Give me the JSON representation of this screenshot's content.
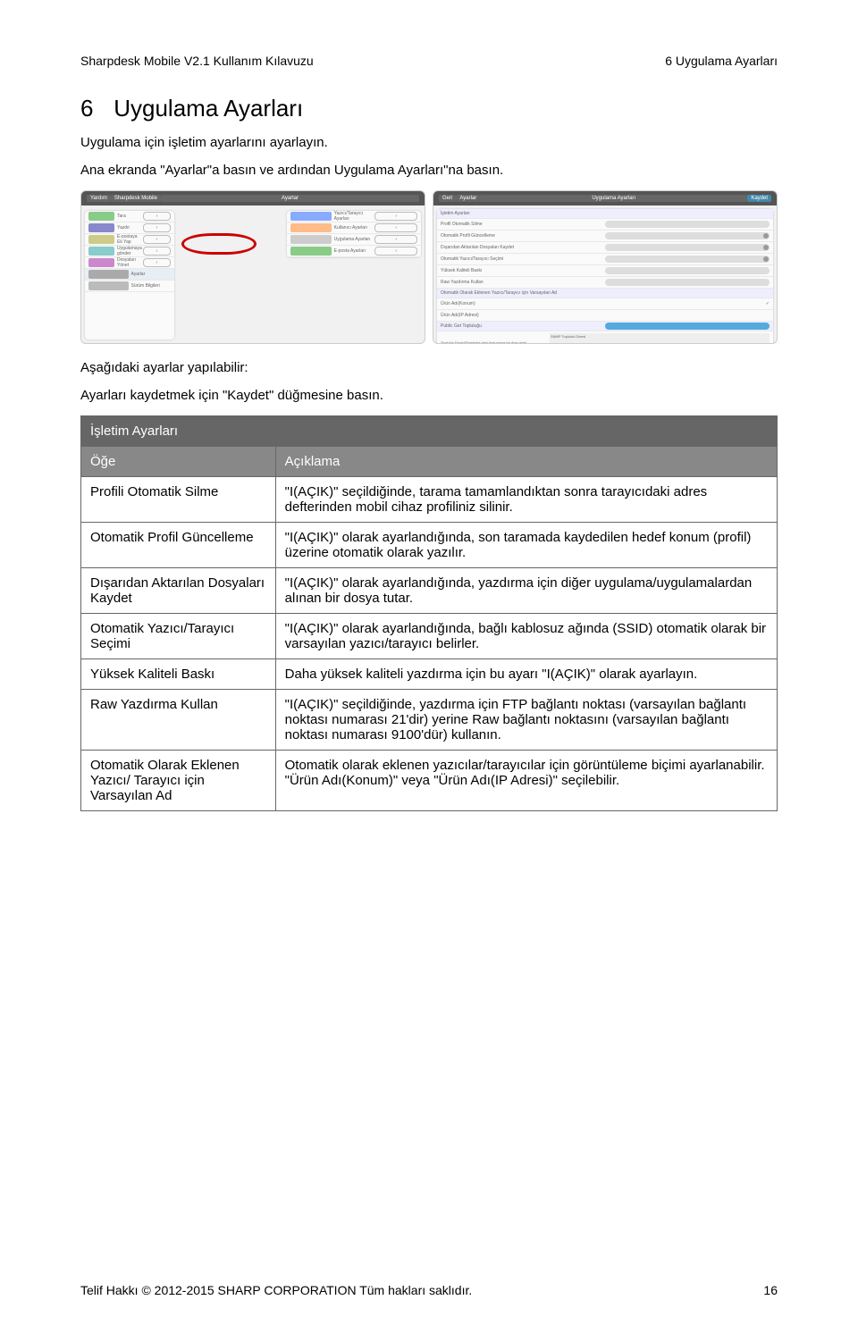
{
  "header": {
    "left": "Sharpdesk Mobile V2.1 Kullanım Kılavuzu",
    "right": "6 Uygulama Ayarları"
  },
  "title": {
    "num": "6",
    "text": "Uygulama Ayarları"
  },
  "intro1": "Uygulama için işletim ayarlarını ayarlayın.",
  "intro2": "Ana ekranda \"Ayarlar\"a basın ve ardından Uygulama Ayarları\"na basın.",
  "shots": {
    "left": {
      "btn_back": "Yardım",
      "crumb": "Sharpdesk Mobile",
      "title": "Ayarlar",
      "left_items": [
        "Tara",
        "Yazdır",
        "E-postaya Ek Yap",
        "Uygulamaya gönder",
        "Dosyaları Yönet",
        "Ayarlar",
        "Sürüm Bilgileri"
      ],
      "right_items": [
        "Yazıcı/Tarayıcı Ayarları",
        "Kullanıcı Ayarları",
        "Uygulama Ayarları",
        "E-posta Ayarları"
      ]
    },
    "right": {
      "btn_back": "Geri",
      "crumb": "Ayarlar",
      "title": "Uygulama Ayarları",
      "btn_save": "Kaydet",
      "section1": "İşletim Ayarları",
      "rows1": [
        "Profil Otomatik Silme",
        "Otomatik Profil Güncelleme",
        "Dışarıdan Aktarılan Dosyaları Kaydet",
        "Otomatik Yazıcı/Tarayıcı Seçimi",
        "Yüksek Kaliteli Baskı",
        "Raw Yazdırma Kullan"
      ],
      "section2": "Otomatik Olarak Eklenen Yazıcı/Tarayıcı için Varsayılan Ad",
      "rows2": [
        "Ürün Adı(Konum)",
        "Ürün Adı(IP Adresi)"
      ],
      "section3": "Public Get Topluluğu",
      "rows3_label": "Topluluk Dizesi/Dizelerini girin (her satıra bir dize girin)",
      "rows3_value": "SNMP Topluluk Dizesi"
    }
  },
  "after1": "Aşağıdaki ayarlar yapılabilir:",
  "after2": "Ayarları kaydetmek için \"Kaydet\" düğmesine basın.",
  "table": {
    "section": "İşletim Ayarları",
    "h1": "Öğe",
    "h2": "Açıklama",
    "rows": [
      {
        "k": "Profili Otomatik Silme",
        "v": "\"I(AÇIK)\" seçildiğinde, tarama tamamlandıktan sonra tarayıcıdaki adres defterinden mobil cihaz profiliniz silinir."
      },
      {
        "k": "Otomatik Profil Güncelleme",
        "v": "\"I(AÇIK)\" olarak ayarlandığında, son taramada kaydedilen hedef konum (profil) üzerine otomatik olarak yazılır."
      },
      {
        "k": "Dışarıdan Aktarılan Dosyaları Kaydet",
        "v": "\"I(AÇIK)\" olarak ayarlandığında, yazdırma için diğer uygulama/uygulamalardan alınan bir dosya tutar."
      },
      {
        "k": "Otomatik Yazıcı/Tarayıcı Seçimi",
        "v": "\"I(AÇIK)\" olarak ayarlandığında, bağlı kablosuz ağında (SSID) otomatik olarak bir varsayılan yazıcı/tarayıcı belirler."
      },
      {
        "k": "Yüksek Kaliteli Baskı",
        "v": "Daha yüksek kaliteli yazdırma için bu ayarı \"I(AÇIK)\" olarak ayarlayın."
      },
      {
        "k": "Raw Yazdırma Kullan",
        "v": "\"I(AÇIK)\" seçildiğinde, yazdırma için FTP bağlantı noktası (varsayılan bağlantı noktası numarası 21'dir) yerine Raw bağlantı noktasını (varsayılan bağlantı noktası numarası 9100'dür) kullanın."
      },
      {
        "k": "Otomatik Olarak Eklenen Yazıcı/ Tarayıcı için Varsayılan Ad",
        "v": "Otomatik olarak eklenen yazıcılar/tarayıcılar için görüntüleme biçimi ayarlanabilir. \"Ürün Adı(Konum)\" veya \"Ürün Adı(IP Adresi)\" seçilebilir."
      }
    ]
  },
  "footer": {
    "left": "Telif Hakkı © 2012-2015 SHARP CORPORATION Tüm hakları saklıdır.",
    "right": "16"
  }
}
